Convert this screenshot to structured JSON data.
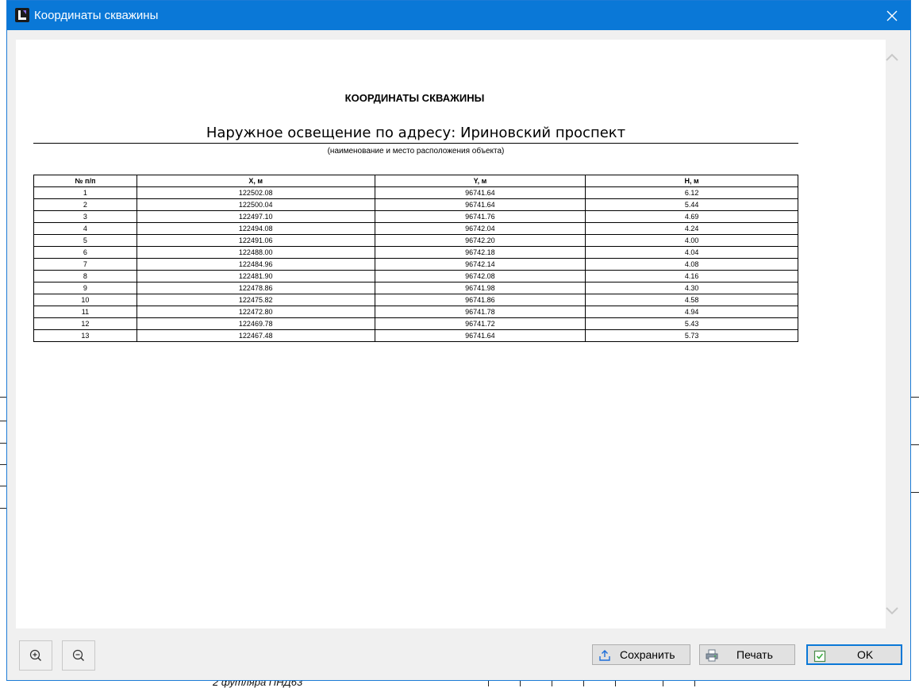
{
  "window": {
    "title": "Координаты скважины"
  },
  "background": {
    "fragment_text": "2 футляра ПНД63"
  },
  "document": {
    "header": "КООРДИНАТЫ СКВАЖИНЫ",
    "subject": "Наружное освещение по адресу: Ириновский проспект",
    "caption": "(наименование и место расположения объекта)",
    "columns": [
      "№ п/п",
      "X, м",
      "Y, м",
      "H, м"
    ],
    "rows": [
      [
        "1",
        "122502.08",
        "96741.64",
        "6.12"
      ],
      [
        "2",
        "122500.04",
        "96741.64",
        "5.44"
      ],
      [
        "3",
        "122497.10",
        "96741.76",
        "4.69"
      ],
      [
        "4",
        "122494.08",
        "96742.04",
        "4.24"
      ],
      [
        "5",
        "122491.06",
        "96742.20",
        "4.00"
      ],
      [
        "6",
        "122488.00",
        "96742.18",
        "4.04"
      ],
      [
        "7",
        "122484.96",
        "96742.14",
        "4.08"
      ],
      [
        "8",
        "122481.90",
        "96742.08",
        "4.16"
      ],
      [
        "9",
        "122478.86",
        "96741.98",
        "4.30"
      ],
      [
        "10",
        "122475.82",
        "96741.86",
        "4.58"
      ],
      [
        "11",
        "122472.80",
        "96741.78",
        "4.94"
      ],
      [
        "12",
        "122469.78",
        "96741.72",
        "5.43"
      ],
      [
        "13",
        "122467.48",
        "96741.64",
        "5.73"
      ]
    ]
  },
  "footer": {
    "zoom_in_icon": "zoom-in-icon",
    "zoom_out_icon": "zoom-out-icon",
    "save_label": "Сохранить",
    "print_label": "Печать",
    "ok_label": "OK"
  },
  "colors": {
    "titlebar": "#0a78d7",
    "dialog_bg": "#f0f0f0",
    "ok_border": "#0a78d7"
  }
}
